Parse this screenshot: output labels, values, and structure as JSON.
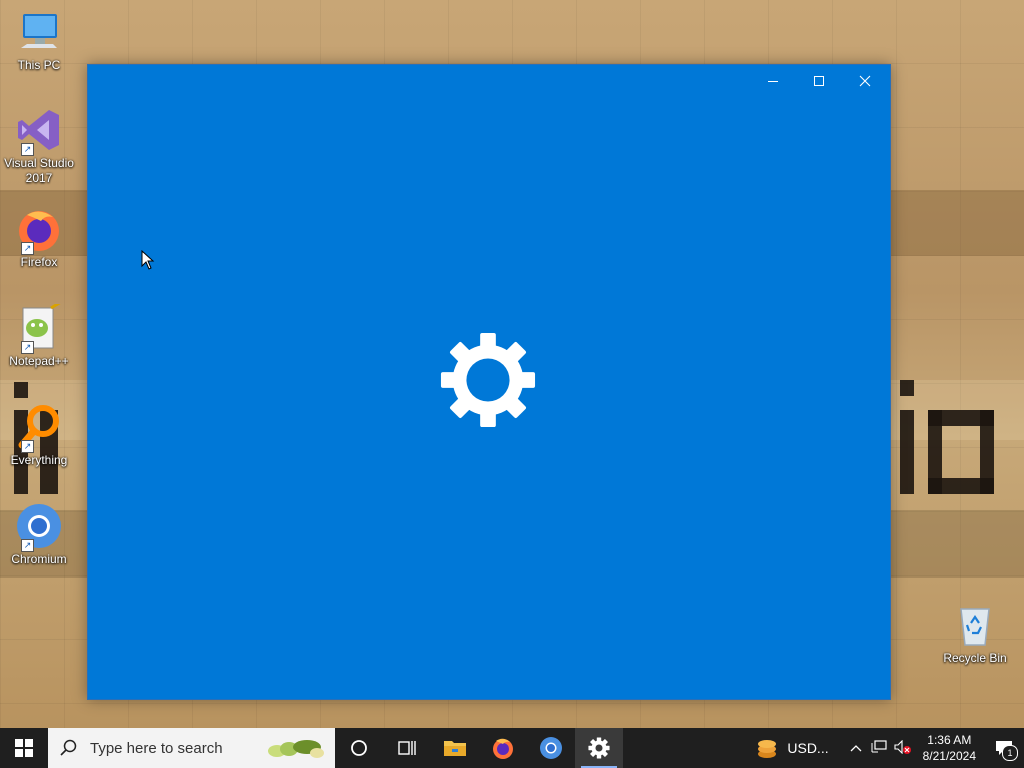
{
  "desktop": {
    "icons": [
      {
        "label": "This PC"
      },
      {
        "label": "Visual Studio 2017"
      },
      {
        "label": "Firefox"
      },
      {
        "label": "Notepad++"
      },
      {
        "label": "Everything"
      },
      {
        "label": "Chromium"
      },
      {
        "label": "Recycle Bin"
      }
    ]
  },
  "window": {
    "app": "settings-gear-icon",
    "accent": "#0078d7"
  },
  "taskbar": {
    "search_placeholder": "Type here to search",
    "weather_text": "USD...",
    "clock_time": "1:36 AM",
    "clock_date": "8/21/2024",
    "notification_count": "1"
  },
  "colors": {
    "taskbar_bg": "#1f1f1f",
    "window_bg": "#0078d7"
  }
}
